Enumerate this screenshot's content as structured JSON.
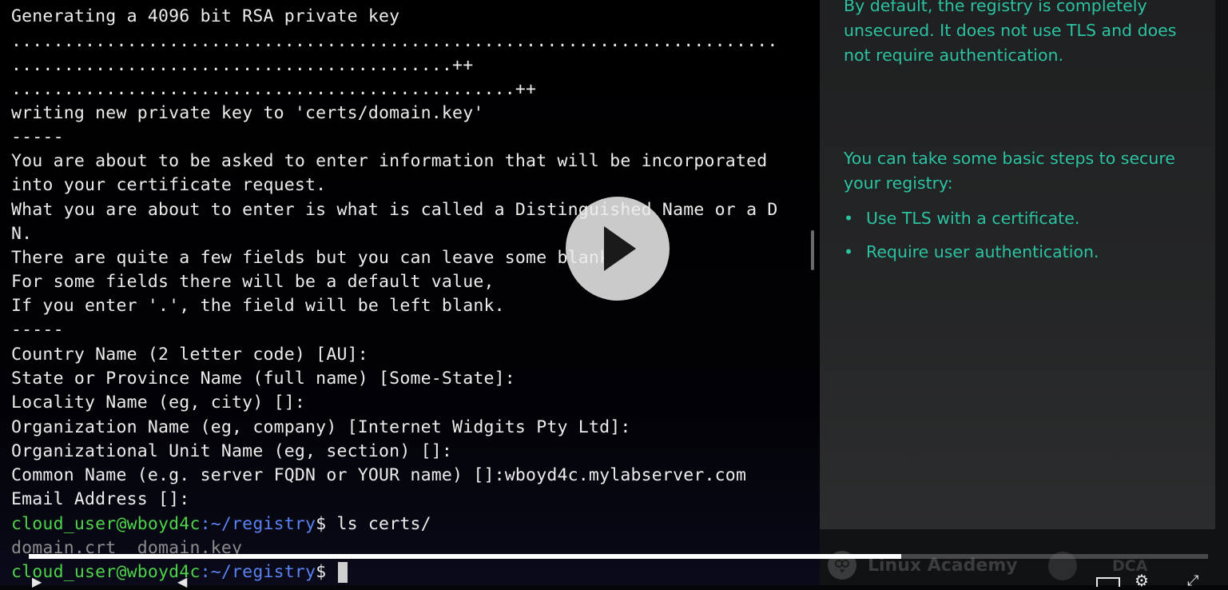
{
  "terminal": {
    "lines": [
      "Generating a 4096 bit RSA private key",
      ".........................................................................",
      "..........................................++",
      "................................................++",
      "writing new private key to 'certs/domain.key'",
      "-----",
      "You are about to be asked to enter information that will be incorporated",
      "into your certificate request.",
      "What you are about to enter is what is called a Distinguished Name or a D",
      "N.",
      "There are quite a few fields but you can leave some blank",
      "For some fields there will be a default value,",
      "If you enter '.', the field will be left blank.",
      "-----",
      "Country Name (2 letter code) [AU]:",
      "State or Province Name (full name) [Some-State]:",
      "Locality Name (eg, city) []:",
      "Organization Name (eg, company) [Internet Widgits Pty Ltd]:",
      "Organizational Unit Name (eg, section) []:",
      "Common Name (e.g. server FQDN or YOUR name) []:wboyd4c.mylabserver.com",
      "Email Address []:"
    ],
    "prompt1": {
      "user": "cloud_user@wboyd4c",
      "path": ":~/registry",
      "symbol": "$ ",
      "command": "ls certs/"
    },
    "ls_output": "domain.crt  domain.key",
    "prompt2": {
      "user": "cloud_user@wboyd4c",
      "path": ":~/registry",
      "symbol": "$ "
    },
    "colors": {
      "user": "#4fd34a",
      "path": "#5a82f0",
      "text": "#ececec"
    }
  },
  "slide": {
    "intro": "By default, the registry is completely unsecured. It does not use TLS and does not require authentication.",
    "steps_heading": "You can take some basic steps to secure your registry:",
    "bullets": [
      "Use TLS with a certificate.",
      "Require user authentication."
    ],
    "accent": "#2bc3a1"
  },
  "branding": {
    "name": "Linux Academy",
    "course": "DCA"
  },
  "player": {
    "progress": 0.74,
    "play_icon": "play-icon"
  }
}
